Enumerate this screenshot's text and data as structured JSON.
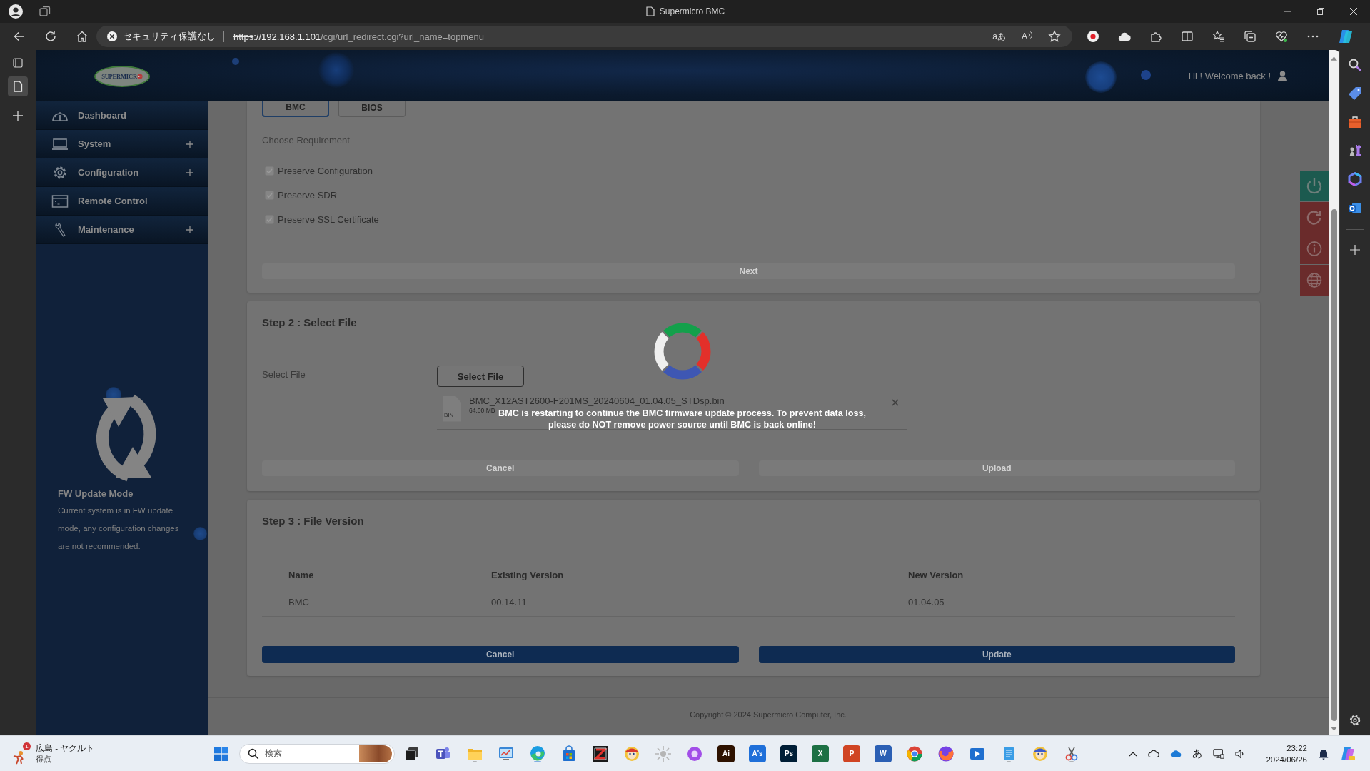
{
  "browser": {
    "title": "Supermicro BMC",
    "security_label": "セキュリティ保護なし",
    "url": {
      "scheme": "https",
      "host": "://192.168.1.101",
      "path": "/cgi/url_redirect.cgi?url_name=topmenu"
    },
    "address_glyphs": [
      "aあ",
      "A"
    ]
  },
  "header": {
    "logo_text": "SUPERMICR",
    "greeting": "Hi ! Welcome back !"
  },
  "sidebar": {
    "items": [
      {
        "label": "Dashboard",
        "expandable": false,
        "selected": false
      },
      {
        "label": "System",
        "expandable": true,
        "selected": false
      },
      {
        "label": "Configuration",
        "expandable": true,
        "selected": false
      },
      {
        "label": "Remote Control",
        "expandable": false,
        "selected": false
      },
      {
        "label": "Maintenance",
        "expandable": true,
        "selected": false
      }
    ],
    "notice": {
      "title": "FW Update Mode",
      "text": "Current system is in FW update mode, any configuration changes are not recommended."
    }
  },
  "step1": {
    "tabs": [
      {
        "label": "BMC",
        "selected": true
      },
      {
        "label": "BIOS",
        "selected": false
      }
    ],
    "requirement_title": "Choose Requirement",
    "options": [
      {
        "label": "Preserve Configuration",
        "checked": true,
        "disabled": true
      },
      {
        "label": "Preserve SDR",
        "checked": true,
        "disabled": true
      },
      {
        "label": "Preserve SSL Certificate",
        "checked": true,
        "disabled": true
      }
    ],
    "next_button": {
      "label": "Next",
      "disabled": true
    }
  },
  "step2": {
    "title": "Step 2 : Select File",
    "field_label": "Select File",
    "select_button": "Select File",
    "file": {
      "type_label": "BIN",
      "name": "BMC_X12AST2600-F201MS_20240604_01.04.05_STDsp.bin",
      "size": "64.00 MB"
    },
    "buttons": [
      {
        "label": "Cancel",
        "disabled": true
      },
      {
        "label": "Upload",
        "disabled": true
      }
    ]
  },
  "step3": {
    "title": "Step 3 : File Version",
    "columns": [
      "Name",
      "Existing Version",
      "New Version"
    ],
    "rows": [
      [
        "BMC",
        "00.14.11",
        "01.04.05"
      ]
    ],
    "buttons": [
      {
        "label": "Cancel",
        "disabled": false
      },
      {
        "label": "Update",
        "disabled": false
      }
    ]
  },
  "modal": {
    "message": "BMC is restarting to continue the BMC firmware update process. To prevent data loss,\nplease do NOT remove power source until BMC is back online!"
  },
  "footer": {
    "copyright": "Copyright © 2024 Supermicro Computer, Inc."
  },
  "taskbar": {
    "news": {
      "badge": "1",
      "headline": "広島 - ヤクルト",
      "subtitle": "得点"
    },
    "search": {
      "placeholder": "検索"
    },
    "letter_apps": [
      {
        "glyph": "Ai",
        "color": "#2e1200"
      },
      {
        "glyph": "A's",
        "color": "#1e6fd9"
      },
      {
        "glyph": "Ps",
        "color": "#001e36"
      },
      {
        "glyph": "X",
        "color": "#1d7044"
      },
      {
        "glyph": "P",
        "color": "#d04423"
      },
      {
        "glyph": "W",
        "color": "#2b5fb4"
      }
    ],
    "ime": "あ",
    "time": "23:22",
    "date": "2024/06/26"
  }
}
